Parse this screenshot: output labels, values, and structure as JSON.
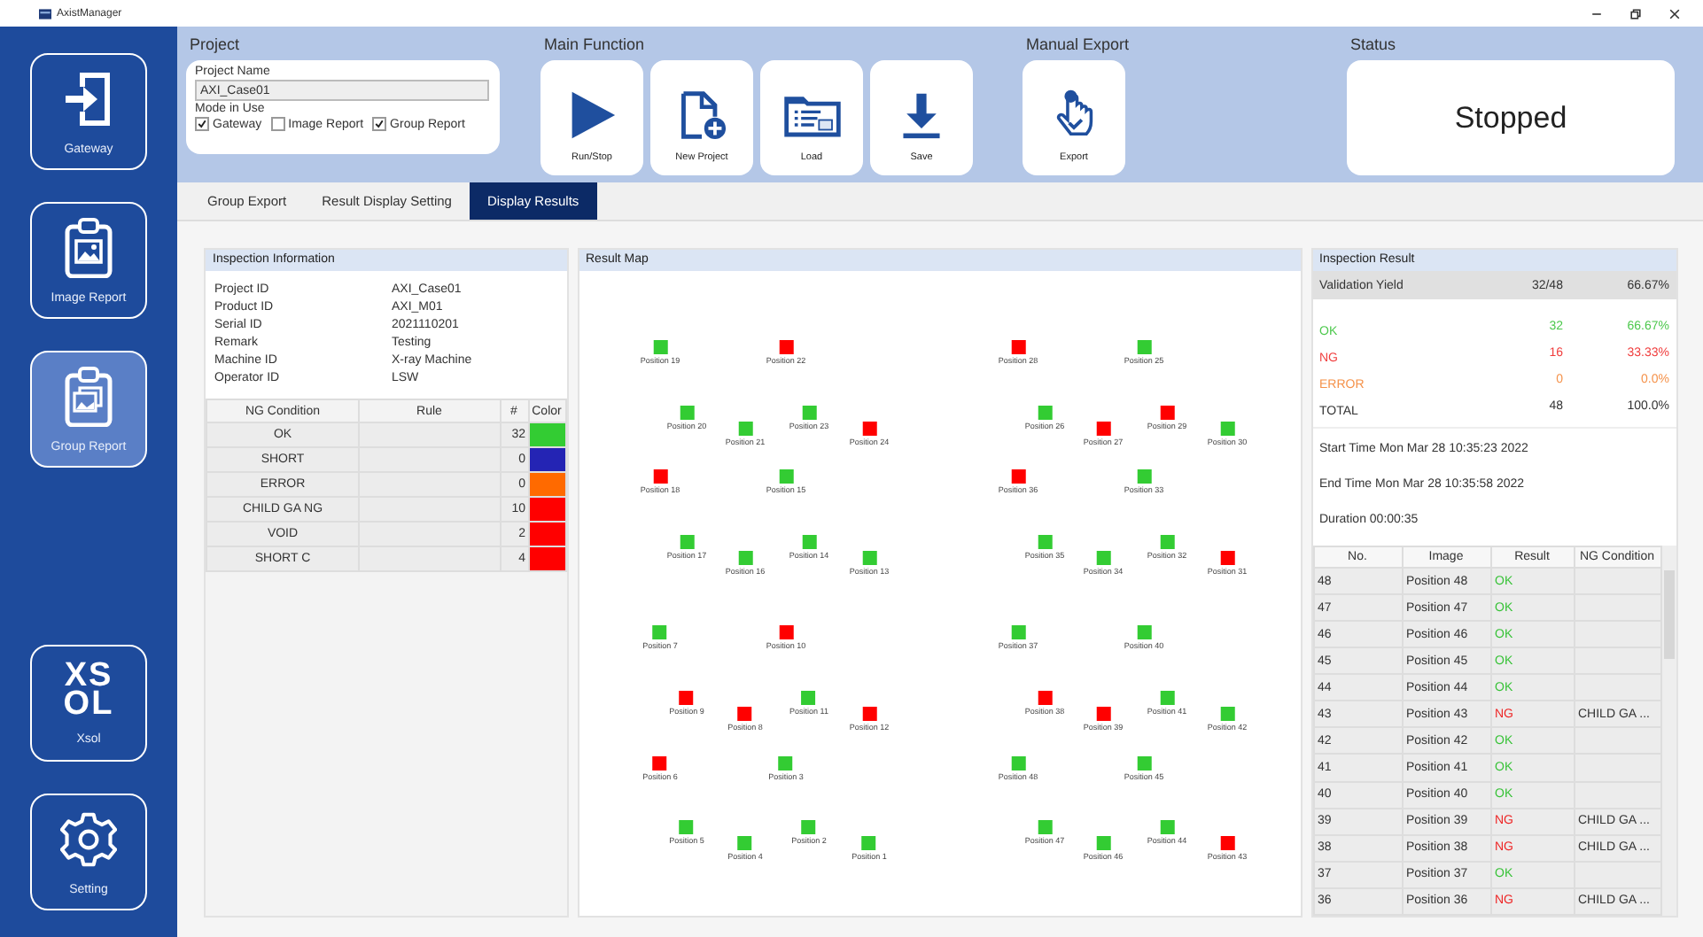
{
  "window": {
    "title": "AxistManager"
  },
  "sidebar": {
    "items": [
      {
        "kind": "enter",
        "label": "Gateway",
        "selected": false
      },
      {
        "kind": "image",
        "label": "Image Report",
        "selected": false
      },
      {
        "kind": "group",
        "label": "Group Report",
        "selected": true
      },
      {
        "kind": "logo",
        "label": "Xsol",
        "logo_lines": [
          "XS",
          "OL"
        ],
        "selected": false
      },
      {
        "kind": "gear",
        "label": "Setting",
        "selected": false
      }
    ]
  },
  "ribbon": {
    "project": {
      "heading": "Project",
      "name_label": "Project Name",
      "name_value": "AXI_Case01",
      "mode_label": "Mode in Use",
      "modes": [
        {
          "label": "Gateway",
          "checked": true
        },
        {
          "label": "Image Report",
          "checked": false
        },
        {
          "label": "Group Report",
          "checked": true
        }
      ]
    },
    "main_function": {
      "heading": "Main Function",
      "buttons": [
        {
          "kind": "play",
          "label": "Run/Stop"
        },
        {
          "kind": "new",
          "label": "New Project"
        },
        {
          "kind": "load",
          "label": "Load"
        },
        {
          "kind": "save",
          "label": "Save"
        }
      ]
    },
    "manual_export": {
      "heading": "Manual Export",
      "buttons": [
        {
          "kind": "export",
          "label": "Export"
        }
      ]
    },
    "status": {
      "heading": "Status",
      "value": "Stopped"
    }
  },
  "tabs": [
    {
      "label": "Group Export",
      "selected": false
    },
    {
      "label": "Result Display Setting",
      "selected": false
    },
    {
      "label": "Display Results",
      "selected": true
    }
  ],
  "inspection_information": {
    "title": "Inspection Information",
    "fields": [
      {
        "label": "Project ID",
        "value": "AXI_Case01"
      },
      {
        "label": "Product ID",
        "value": "AXI_M01"
      },
      {
        "label": "Serial ID",
        "value": "2021110201"
      },
      {
        "label": "Remark",
        "value": "Testing"
      },
      {
        "label": "Machine ID",
        "value": "X-ray Machine"
      },
      {
        "label": "Operator ID",
        "value": "LSW"
      }
    ],
    "ng_table": {
      "columns": [
        "NG Condition",
        "Rule",
        "#",
        "Color"
      ],
      "rows": [
        {
          "condition": "OK",
          "count": "32",
          "color": "#33cc33"
        },
        {
          "condition": "SHORT",
          "count": "0",
          "color": "#2424b4"
        },
        {
          "condition": "ERROR",
          "count": "0",
          "color": "#ff6a00"
        },
        {
          "condition": "CHILD GA NG",
          "count": "10",
          "color": "#ff0000"
        },
        {
          "condition": "VOID",
          "count": "2",
          "color": "#ff0000"
        },
        {
          "condition": "SHORT C",
          "count": "4",
          "color": "#ff0000"
        }
      ]
    }
  },
  "result_map": {
    "title": "Result Map",
    "blocks": [
      {
        "rows": [
          [
            {
              "label": "Position 19",
              "color": "#33cc33"
            },
            {
              "label": "Position 22",
              "color": "#ff0000"
            }
          ],
          [
            {
              "label": "Position 20",
              "color": "#33cc33"
            },
            {
              "label": "Position 21",
              "color": "#33cc33"
            },
            {
              "label": "Position 23",
              "color": "#33cc33"
            },
            {
              "label": "Position 24",
              "color": "#ff0000"
            }
          ],
          [
            {
              "label": "Position 18",
              "color": "#ff0000"
            },
            {
              "label": "Position 15",
              "color": "#33cc33"
            }
          ],
          [
            {
              "label": "Position 17",
              "color": "#33cc33"
            },
            {
              "label": "Position 16",
              "color": "#33cc33"
            },
            {
              "label": "Position 14",
              "color": "#33cc33"
            },
            {
              "label": "Position 13",
              "color": "#33cc33"
            }
          ],
          [
            {
              "label": "Position 7",
              "color": "#33cc33"
            },
            {
              "label": "Position 10",
              "color": "#ff0000"
            }
          ],
          [
            {
              "label": "Position 9",
              "color": "#ff0000"
            },
            {
              "label": "Position 8",
              "color": "#ff0000"
            },
            {
              "label": "Position 11",
              "color": "#33cc33"
            },
            {
              "label": "Position 12",
              "color": "#ff0000"
            }
          ],
          [
            {
              "label": "Position 6",
              "color": "#ff0000"
            },
            {
              "label": "Position 3",
              "color": "#33cc33"
            }
          ],
          [
            {
              "label": "Position 5",
              "color": "#33cc33"
            },
            {
              "label": "Position 4",
              "color": "#33cc33"
            },
            {
              "label": "Position 2",
              "color": "#33cc33"
            },
            {
              "label": "Position 1",
              "color": "#33cc33"
            }
          ]
        ]
      },
      {
        "rows": [
          [
            {
              "label": "Position 28",
              "color": "#ff0000"
            },
            {
              "label": "Position 25",
              "color": "#33cc33"
            }
          ],
          [
            {
              "label": "Position 26",
              "color": "#33cc33"
            },
            {
              "label": "Position 27",
              "color": "#ff0000"
            },
            {
              "label": "Position 29",
              "color": "#ff0000"
            },
            {
              "label": "Position 30",
              "color": "#33cc33"
            }
          ],
          [
            {
              "label": "Position 36",
              "color": "#ff0000"
            },
            {
              "label": "Position 33",
              "color": "#33cc33"
            }
          ],
          [
            {
              "label": "Position 35",
              "color": "#33cc33"
            },
            {
              "label": "Position 34",
              "color": "#33cc33"
            },
            {
              "label": "Position 32",
              "color": "#33cc33"
            },
            {
              "label": "Position 31",
              "color": "#ff0000"
            }
          ],
          [
            {
              "label": "Position 37",
              "color": "#33cc33"
            },
            {
              "label": "Position 40",
              "color": "#33cc33"
            }
          ],
          [
            {
              "label": "Position 38",
              "color": "#ff0000"
            },
            {
              "label": "Position 39",
              "color": "#ff0000"
            },
            {
              "label": "Position 41",
              "color": "#33cc33"
            },
            {
              "label": "Position 42",
              "color": "#33cc33"
            }
          ],
          [
            {
              "label": "Position 48",
              "color": "#33cc33"
            },
            {
              "label": "Position 45",
              "color": "#33cc33"
            }
          ],
          [
            {
              "label": "Position 47",
              "color": "#33cc33"
            },
            {
              "label": "Position 46",
              "color": "#33cc33"
            },
            {
              "label": "Position 44",
              "color": "#33cc33"
            },
            {
              "label": "Position 43",
              "color": "#ff0000"
            }
          ]
        ]
      }
    ]
  },
  "inspection_result": {
    "title": "Inspection Result",
    "yield": {
      "label": "Validation Yield",
      "count": "32/48",
      "percent": "66.67%"
    },
    "stats": [
      {
        "kind": "ok",
        "label": "OK",
        "count": "32",
        "percent": "66.67%"
      },
      {
        "kind": "ng",
        "label": "NG",
        "count": "16",
        "percent": "33.33%"
      },
      {
        "kind": "error",
        "label": "ERROR",
        "count": "0",
        "percent": "0.0%"
      },
      {
        "kind": "total",
        "label": "TOTAL",
        "count": "48",
        "percent": "100.0%"
      }
    ],
    "times": [
      "Start Time Mon Mar 28 10:35:23 2022",
      "End Time Mon Mar 28 10:35:58 2022",
      "Duration 00:00:35"
    ],
    "table": {
      "columns": [
        "No.",
        "Image",
        "Result",
        "NG Condition"
      ],
      "rows": [
        {
          "no": "48",
          "image": "Position 48",
          "kind": "ok",
          "result": "OK"
        },
        {
          "no": "47",
          "image": "Position 47",
          "kind": "ok",
          "result": "OK"
        },
        {
          "no": "46",
          "image": "Position 46",
          "kind": "ok",
          "result": "OK"
        },
        {
          "no": "45",
          "image": "Position 45",
          "kind": "ok",
          "result": "OK"
        },
        {
          "no": "44",
          "image": "Position 44",
          "kind": "ok",
          "result": "OK"
        },
        {
          "no": "43",
          "image": "Position 43",
          "kind": "ng",
          "result": "NG",
          "ng_condition": "CHILD GA ..."
        },
        {
          "no": "42",
          "image": "Position 42",
          "kind": "ok",
          "result": "OK"
        },
        {
          "no": "41",
          "image": "Position 41",
          "kind": "ok",
          "result": "OK"
        },
        {
          "no": "40",
          "image": "Position 40",
          "kind": "ok",
          "result": "OK"
        },
        {
          "no": "39",
          "image": "Position 39",
          "kind": "ng",
          "result": "NG",
          "ng_condition": "CHILD GA ..."
        },
        {
          "no": "38",
          "image": "Position 38",
          "kind": "ng",
          "result": "NG",
          "ng_condition": "CHILD GA ..."
        },
        {
          "no": "37",
          "image": "Position 37",
          "kind": "ok",
          "result": "OK"
        },
        {
          "no": "36",
          "image": "Position 36",
          "kind": "ng",
          "result": "NG",
          "ng_condition": "CHILD GA ..."
        }
      ]
    }
  }
}
